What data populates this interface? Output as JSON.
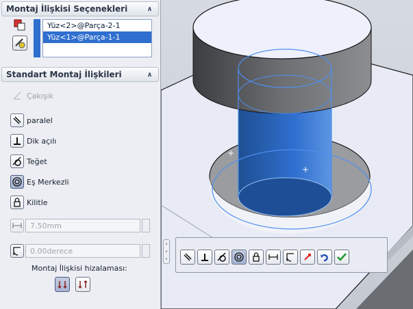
{
  "mate_selections": {
    "title": "Montaj İlişkisi Seçenekleri",
    "items": [
      "Yüz<2>@Parça-2-1",
      "Yüz<1>@Parça-1-1"
    ],
    "selected_index": 1
  },
  "standard_mates": {
    "title": "Standart Montaj İlişkileri",
    "options": [
      {
        "label": "Çakışık",
        "icon": "coincident-icon",
        "enabled": false,
        "active": false
      },
      {
        "label": "paralel",
        "icon": "parallel-icon",
        "enabled": true,
        "active": false
      },
      {
        "label": "Dik açılı",
        "icon": "perpendicular-icon",
        "enabled": true,
        "active": false
      },
      {
        "label": "Teğet",
        "icon": "tangent-icon",
        "enabled": true,
        "active": false
      },
      {
        "label": "Eş Merkezli",
        "icon": "concentric-icon",
        "enabled": true,
        "active": true
      },
      {
        "label": "Kilitle",
        "icon": "lock-icon",
        "enabled": true,
        "active": false
      }
    ],
    "distance_value": "7.50mm",
    "angle_value": "0.00derece",
    "alignment_label": "Montaj İlişkisi hizalaması:",
    "alignment_buttons": [
      "aligned-icon",
      "anti-aligned-icon"
    ]
  },
  "popup_toolbar": {
    "buttons": [
      "parallel-icon",
      "perpendicular-icon",
      "tangent-icon",
      "concentric-icon",
      "lock-icon",
      "distance-icon",
      "angle-icon",
      "flip-alignment-icon",
      "undo-icon",
      "ok-check-icon"
    ],
    "active_index": 3
  },
  "colors": {
    "accent": "#2f6fcf",
    "model_gray": "#6f7275",
    "model_top": "#eef0fb",
    "highlight_blue": "#3a7fd8"
  }
}
